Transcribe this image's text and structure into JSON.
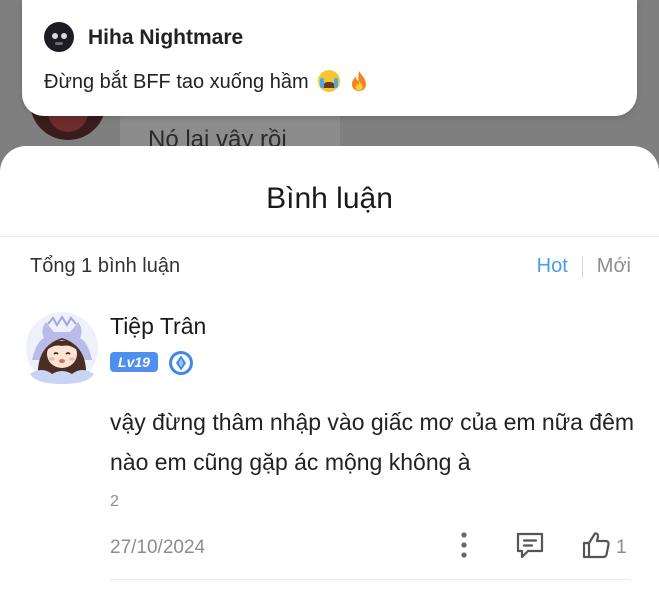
{
  "background": {
    "peek_text": "Nó lại vậy rồi"
  },
  "notification": {
    "sender_name": "Hiha Nightmare",
    "message": "Đừng bắt BFF tao xuống hầm",
    "emoji_icons": [
      "crying-face-icon",
      "fire-icon"
    ]
  },
  "sheet": {
    "title": "Bình luận",
    "count_label": "Tổng 1 bình luận",
    "sort_tabs": [
      {
        "label": "Hot",
        "active": true
      },
      {
        "label": "Mới",
        "active": false
      }
    ]
  },
  "comment": {
    "author": "Tiệp Trân",
    "level_badge": "Lv19",
    "text": "vậy đừng thâm nhập vào giấc mơ của em nữa đêm nào em cũng gặp ác mộng không à",
    "number": "2",
    "date": "27/10/2024",
    "like_count": "1"
  },
  "colors": {
    "accent": "#4a9ee6",
    "level_badge": "#4f8ff0",
    "muted_text": "#8d8d8d"
  }
}
